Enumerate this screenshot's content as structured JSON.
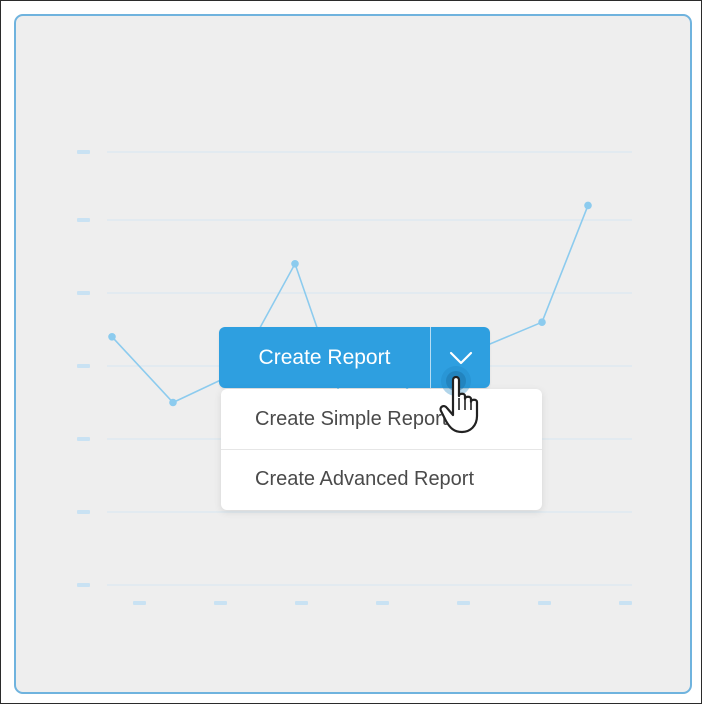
{
  "create_button": {
    "label": "Create Report",
    "toggle_icon": "chevron-down-icon"
  },
  "dropdown": {
    "items": [
      {
        "label": "Create Simple Report"
      },
      {
        "label": "Create Advanced Report"
      }
    ]
  },
  "cursor": {
    "icon": "hand-pointer-icon"
  },
  "colors": {
    "accent": "#2e9fe0",
    "panel_bg": "#eeeeee",
    "panel_border": "#6fb3de",
    "chart_line": "#8ccbee"
  },
  "chart_data": {
    "type": "line",
    "decorative_placeholder": true,
    "series": [
      {
        "values": [
          3.4,
          2.5,
          2.9,
          4.4,
          1.9,
          2.9,
          3.6,
          5.2
        ]
      }
    ],
    "grid": true
  }
}
